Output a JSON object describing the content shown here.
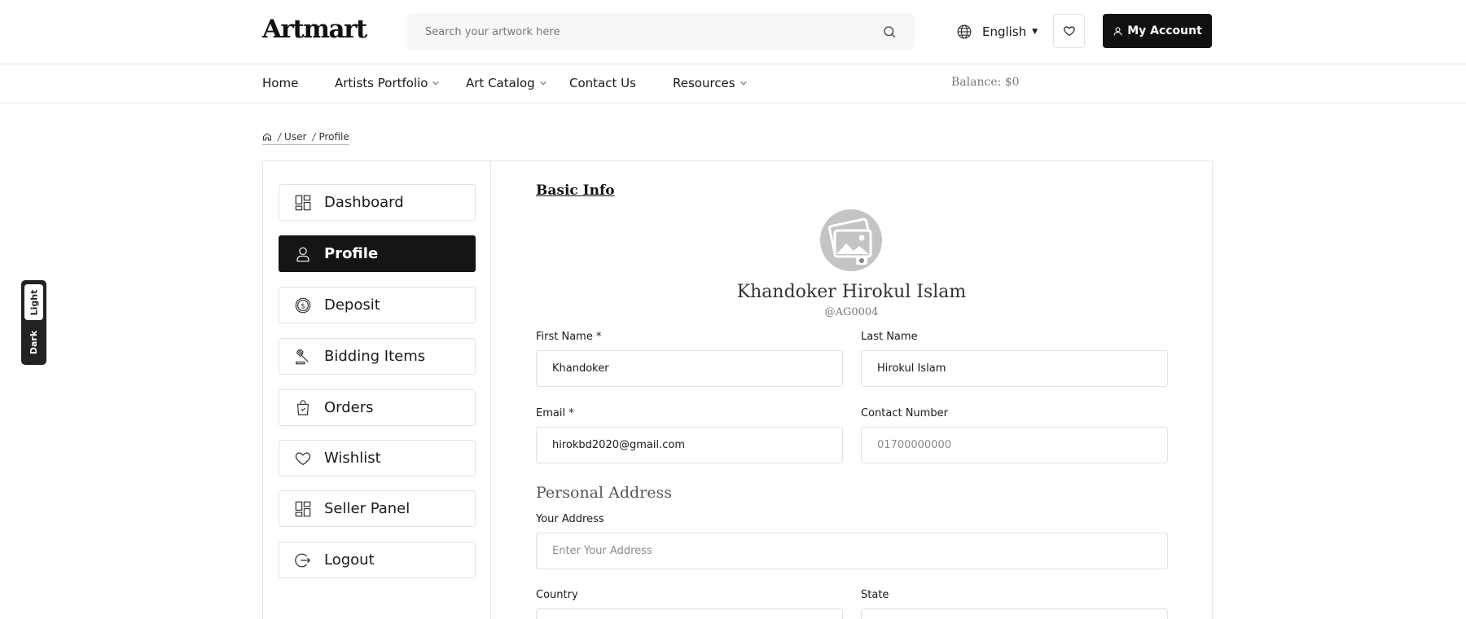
{
  "header": {
    "logo": "Artmart",
    "search_placeholder": "Search your artwork here",
    "language": "English",
    "account_label": "My Account"
  },
  "nav": {
    "items": [
      {
        "label": "Home"
      },
      {
        "label": "Artists Portfolio"
      },
      {
        "label": "Art Catalog"
      },
      {
        "label": "Contact Us"
      },
      {
        "label": "Resources"
      }
    ],
    "balance": "Balance: $0"
  },
  "breadcrumb": {
    "items": [
      "User",
      "Profile"
    ]
  },
  "sidebar": {
    "items": [
      {
        "label": "Dashboard",
        "icon": "dashboard-icon"
      },
      {
        "label": "Profile",
        "icon": "user-icon",
        "active": true
      },
      {
        "label": "Deposit",
        "icon": "dollar-coin-icon"
      },
      {
        "label": "Bidding Items",
        "icon": "gavel-icon"
      },
      {
        "label": "Orders",
        "icon": "shopping-bag-icon"
      },
      {
        "label": "Wishlist",
        "icon": "heart-icon"
      },
      {
        "label": "Seller Panel",
        "icon": "dashboard-icon"
      },
      {
        "label": "Logout",
        "icon": "logout-icon"
      }
    ]
  },
  "profile": {
    "section_title": "Basic Info",
    "name": "Khandoker Hirokul Islam",
    "handle": "@AG0004",
    "first_name_label": "First Name *",
    "first_name_value": "Khandoker",
    "last_name_label": "Last Name",
    "last_name_value": "Hirokul Islam",
    "email_label": "Email *",
    "email_value": "hirokbd2020@gmail.com",
    "contact_label": "Contact Number",
    "contact_placeholder": "01700000000",
    "address_section": "Personal Address",
    "address_label": "Your Address",
    "address_placeholder": "Enter Your Address",
    "country_label": "Country",
    "state_label": "State"
  },
  "theme": {
    "light": "Light",
    "dark": "Dark"
  },
  "colors": {
    "primary": "#151515",
    "border": "#e2e2e2",
    "search_bg": "#f8f6f6"
  }
}
